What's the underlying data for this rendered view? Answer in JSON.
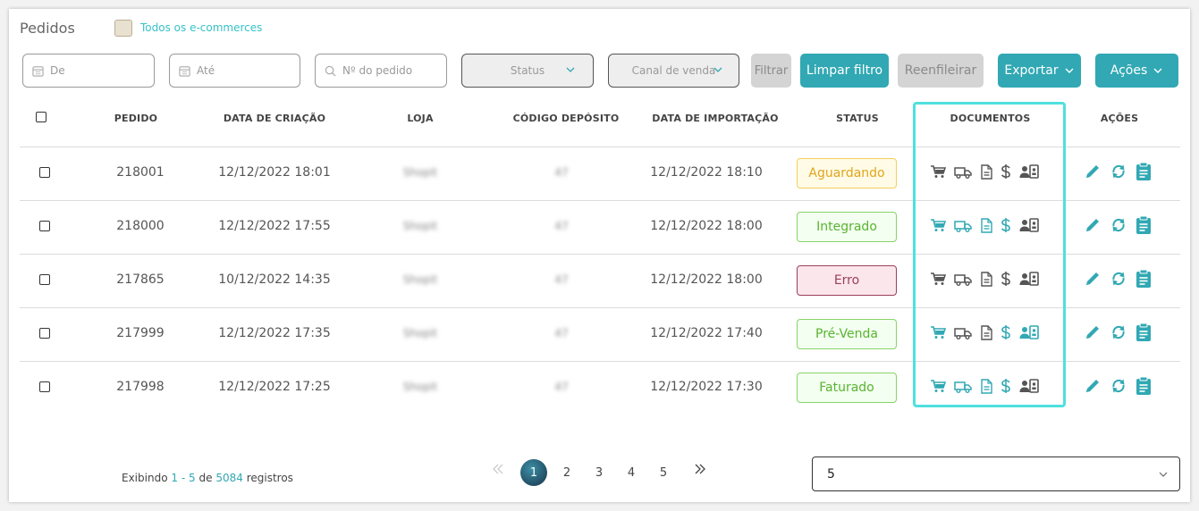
{
  "page": {
    "title": "Pedidos",
    "ecommerce_label": "Todos os e-commerces"
  },
  "filters": {
    "date_from": "De",
    "date_to": "Até",
    "order_number": "Nº do pedido",
    "status": "Status",
    "channel": "Canal de venda",
    "filter_button": "Filtrar",
    "clear_button": "Limpar filtro",
    "requeue_button": "Reenfileirar",
    "export_button": "Exportar",
    "actions_button": "Ações"
  },
  "table": {
    "headers": {
      "pedido": "PEDIDO",
      "data_criacao": "DATA DE CRIAÇÃO",
      "loja": "LOJA",
      "codigo_deposito": "CÓDIGO DEPÓSITO",
      "data_importacao": "DATA DE IMPORTAÇÃO",
      "status": "STATUS",
      "documentos": "DOCUMENTOS",
      "acoes": "AÇÕES"
    },
    "rows": [
      {
        "pedido": "218001",
        "created": "12/12/2022 18:01",
        "store": "Shopit",
        "depot": "47",
        "imported": "12/12/2022 18:10",
        "status": "Aguardando",
        "status_kind": "wait",
        "docs_active": [
          false,
          false,
          false,
          false,
          false
        ]
      },
      {
        "pedido": "218000",
        "created": "12/12/2022 17:55",
        "store": "Shopit",
        "depot": "47",
        "imported": "12/12/2022 18:00",
        "status": "Integrado",
        "status_kind": "ok",
        "docs_active": [
          true,
          true,
          true,
          true,
          false
        ]
      },
      {
        "pedido": "217865",
        "created": "10/12/2022 14:35",
        "store": "Shopit",
        "depot": "47",
        "imported": "12/12/2022 18:00",
        "status": "Erro",
        "status_kind": "err",
        "docs_active": [
          false,
          false,
          false,
          false,
          false
        ]
      },
      {
        "pedido": "217999",
        "created": "12/12/2022 17:35",
        "store": "Shopit",
        "depot": "47",
        "imported": "12/12/2022 17:40",
        "status": "Pré-Venda",
        "status_kind": "ok",
        "docs_active": [
          true,
          false,
          false,
          true,
          true
        ]
      },
      {
        "pedido": "217998",
        "created": "12/12/2022 17:25",
        "store": "Shopit",
        "depot": "47",
        "imported": "12/12/2022 17:30",
        "status": "Faturado",
        "status_kind": "ok",
        "docs_active": [
          true,
          true,
          true,
          true,
          false
        ]
      }
    ],
    "doc_icons": [
      "cart-icon",
      "truck-icon",
      "invoice-icon",
      "dollar-icon",
      "contact-card-icon"
    ],
    "action_icons": [
      "pencil-icon",
      "sync-icon",
      "clipboard-icon"
    ]
  },
  "pagination": {
    "pages": [
      "1",
      "2",
      "3",
      "4",
      "5"
    ],
    "current": "1",
    "showing_prefix": "Exibindo",
    "from": "1",
    "dash": "-",
    "to": "5",
    "of_word": "de",
    "total": "5084",
    "suffix": "registros",
    "page_size": "5"
  },
  "colors": {
    "teal": "#31a8b3",
    "highlight": "#4fe0de",
    "icon_gray": "#555555"
  }
}
